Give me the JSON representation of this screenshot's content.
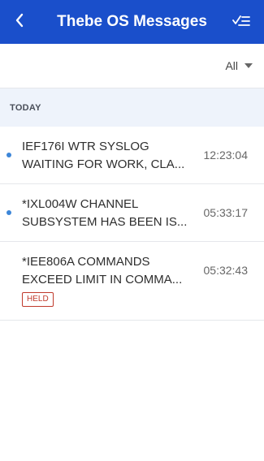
{
  "header": {
    "title": "Thebe OS Messages",
    "back_icon": "back-arrow-icon",
    "action_icon": "mark-all-read-icon",
    "bg_color": "#1a4fcb"
  },
  "filter": {
    "selected": "All"
  },
  "sections": [
    {
      "label": "TODAY",
      "messages": [
        {
          "line1": "IEF176I WTR SYSLOG",
          "line2": "WAITING FOR WORK, CLA...",
          "time": "12:23:04",
          "unread": true,
          "held": false
        },
        {
          "line1": "*IXL004W CHANNEL",
          "line2": "SUBSYSTEM HAS BEEN IS...",
          "time": "05:33:17",
          "unread": true,
          "held": false
        },
        {
          "line1": "*IEE806A COMMANDS",
          "line2": "EXCEED LIMIT IN COMMA...",
          "time": "05:32:43",
          "unread": false,
          "held": true,
          "held_label": "HELD"
        }
      ]
    }
  ],
  "colors": {
    "unread_dot": "#3d86d8",
    "held_badge": "#c0392b",
    "section_bg": "#eef3fb"
  }
}
